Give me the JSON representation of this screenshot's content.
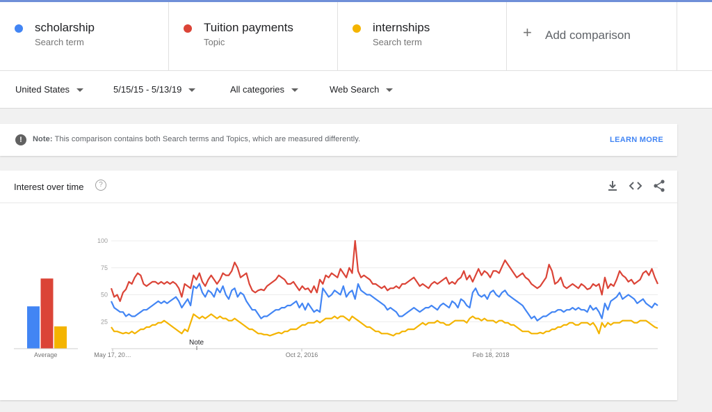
{
  "terms": [
    {
      "name": "scholarship",
      "type": "Search term",
      "color": "#4285f4"
    },
    {
      "name": "Tuition payments",
      "type": "Topic",
      "color": "#db4437"
    },
    {
      "name": "internships",
      "type": "Search term",
      "color": "#f4b400"
    }
  ],
  "add_comparison": {
    "icon": "+",
    "label": "Add comparison"
  },
  "filters": {
    "region": "United States",
    "date_range": "5/15/15 - 5/13/19",
    "category": "All categories",
    "search_type": "Web Search"
  },
  "note": {
    "icon": "!",
    "label": "Note:",
    "text": "This comparison contains both Search terms and Topics, which are measured differently.",
    "link": "LEARN MORE"
  },
  "chart": {
    "title": "Interest over time",
    "help_icon": "?",
    "average_label": "Average",
    "note_marker": "Note",
    "icons": [
      "download-icon",
      "embed-icon",
      "share-icon"
    ]
  },
  "chart_data": {
    "type": "line",
    "ylim": [
      0,
      100
    ],
    "yticks": [
      25,
      50,
      75,
      100
    ],
    "xticks": [
      "May 17, 20…",
      "Oct 2, 2016",
      "Feb 18, 2018"
    ],
    "averages": [
      {
        "name": "scholarship",
        "value": 38,
        "color": "#4285f4"
      },
      {
        "name": "Tuition payments",
        "value": 63,
        "color": "#db4437"
      },
      {
        "name": "internships",
        "value": 20,
        "color": "#f4b400"
      }
    ],
    "series": [
      {
        "name": "Tuition payments",
        "color": "#db4437",
        "values": [
          56,
          48,
          50,
          44,
          52,
          55,
          62,
          60,
          66,
          70,
          68,
          60,
          58,
          60,
          62,
          62,
          60,
          62,
          60,
          62,
          60,
          62,
          60,
          56,
          48,
          60,
          58,
          56,
          68,
          64,
          70,
          62,
          58,
          64,
          68,
          64,
          60,
          64,
          70,
          68,
          68,
          72,
          80,
          75,
          66,
          68,
          70,
          60,
          54,
          52,
          54,
          55,
          54,
          58,
          60,
          62,
          64,
          68,
          66,
          64,
          60,
          60,
          62,
          58,
          54,
          58,
          55,
          56,
          52,
          58,
          52,
          64,
          60,
          68,
          66,
          70,
          68,
          66,
          74,
          70,
          66,
          75,
          70,
          100,
          72,
          66,
          68,
          66,
          64,
          60,
          60,
          58,
          56,
          58,
          54,
          56,
          56,
          58,
          56,
          60,
          60,
          62,
          64,
          66,
          62,
          58,
          60,
          58,
          56,
          60,
          62,
          60,
          62,
          64,
          66,
          60,
          62,
          60,
          64,
          66,
          72,
          64,
          68,
          62,
          68,
          74,
          68,
          72,
          70,
          66,
          72,
          72,
          70,
          76,
          82,
          78,
          74,
          70,
          66,
          68,
          70,
          66,
          64,
          60,
          58,
          56,
          58,
          62,
          66,
          78,
          72,
          60,
          62,
          66,
          58,
          56,
          58,
          60,
          58,
          56,
          60,
          58,
          55,
          56,
          60,
          58,
          60,
          50,
          66,
          56,
          60,
          58,
          64,
          72,
          68,
          66,
          62,
          64,
          60,
          62,
          64,
          70,
          72,
          68,
          74,
          66,
          60
        ]
      },
      {
        "name": "scholarship",
        "color": "#4285f4",
        "values": [
          44,
          38,
          36,
          34,
          34,
          30,
          32,
          30,
          30,
          32,
          34,
          36,
          36,
          38,
          40,
          42,
          44,
          42,
          44,
          42,
          44,
          46,
          48,
          44,
          38,
          42,
          46,
          40,
          58,
          56,
          60,
          52,
          48,
          54,
          52,
          48,
          56,
          52,
          58,
          50,
          46,
          54,
          56,
          48,
          52,
          50,
          44,
          40,
          36,
          36,
          32,
          28,
          30,
          30,
          32,
          34,
          36,
          36,
          38,
          38,
          40,
          40,
          42,
          44,
          38,
          42,
          36,
          42,
          38,
          34,
          36,
          34,
          56,
          52,
          48,
          50,
          54,
          52,
          50,
          58,
          48,
          52,
          54,
          46,
          60,
          54,
          52,
          50,
          50,
          48,
          46,
          44,
          42,
          40,
          36,
          38,
          36,
          34,
          30,
          30,
          32,
          34,
          36,
          38,
          36,
          34,
          36,
          38,
          38,
          40,
          38,
          36,
          40,
          42,
          40,
          38,
          44,
          42,
          38,
          46,
          44,
          40,
          38,
          52,
          56,
          50,
          48,
          50,
          46,
          52,
          54,
          50,
          48,
          52,
          54,
          50,
          48,
          46,
          44,
          42,
          40,
          36,
          32,
          28,
          30,
          26,
          28,
          30,
          30,
          32,
          34,
          34,
          36,
          36,
          34,
          36,
          36,
          38,
          36,
          38,
          36,
          36,
          34,
          40,
          36,
          38,
          34,
          28,
          42,
          36,
          44,
          46,
          48,
          52,
          46,
          48,
          50,
          48,
          46,
          42,
          44,
          46,
          42,
          40,
          38,
          42,
          40
        ]
      },
      {
        "name": "internships",
        "color": "#f4b400",
        "values": [
          20,
          16,
          16,
          15,
          14,
          15,
          14,
          16,
          14,
          16,
          18,
          18,
          20,
          20,
          22,
          22,
          24,
          24,
          26,
          24,
          22,
          20,
          18,
          16,
          14,
          18,
          16,
          24,
          32,
          30,
          28,
          30,
          28,
          30,
          32,
          30,
          28,
          30,
          28,
          28,
          26,
          26,
          28,
          26,
          24,
          22,
          20,
          18,
          18,
          16,
          14,
          14,
          13,
          13,
          12,
          13,
          14,
          15,
          14,
          16,
          16,
          18,
          18,
          18,
          20,
          22,
          22,
          24,
          24,
          24,
          26,
          24,
          26,
          28,
          28,
          28,
          30,
          28,
          30,
          30,
          28,
          26,
          30,
          28,
          26,
          24,
          22,
          20,
          20,
          18,
          16,
          16,
          14,
          14,
          14,
          13,
          12,
          14,
          14,
          16,
          16,
          18,
          18,
          18,
          20,
          22,
          24,
          22,
          24,
          24,
          24,
          26,
          24,
          24,
          22,
          22,
          24,
          26,
          26,
          26,
          26,
          24,
          28,
          30,
          28,
          28,
          26,
          28,
          26,
          26,
          26,
          24,
          26,
          26,
          24,
          24,
          22,
          22,
          20,
          18,
          16,
          16,
          16,
          14,
          14,
          14,
          15,
          14,
          16,
          16,
          18,
          18,
          20,
          20,
          22,
          22,
          24,
          24,
          22,
          22,
          24,
          24,
          24,
          22,
          24,
          20,
          14,
          24,
          20,
          24,
          22,
          24,
          24,
          24,
          26,
          26,
          26,
          26,
          24,
          24,
          26,
          26,
          26,
          24,
          22,
          20,
          19
        ]
      }
    ]
  }
}
